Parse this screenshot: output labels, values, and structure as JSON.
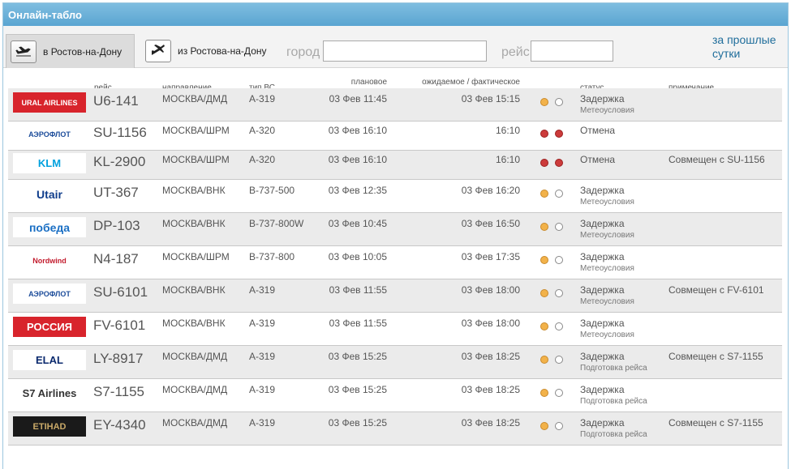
{
  "title": "Онлайн-табло",
  "tabs": [
    {
      "label": "в Ростов-на-Дону",
      "active": true
    },
    {
      "label": "из Ростова-на-Дону",
      "active": false
    }
  ],
  "filters": {
    "city_label": "город",
    "city_value": "",
    "flight_label": "рейс",
    "flight_value": ""
  },
  "prev_day_link": "за прошлые сутки",
  "headers": {
    "flight": "рейс",
    "direction": "направление",
    "aircraft": "тип ВС",
    "planned": "плановое время",
    "expected": "ожидаемое / фактическое время",
    "status": "статус",
    "note": "примечание"
  },
  "rows": [
    {
      "airline": "Ural Airlines",
      "logo": "URAL AIRLINES",
      "flight": "U6-141",
      "direction": "МОСКВА/ДМД",
      "aircraft": "A-319",
      "planned": "03 Фев 11:45",
      "expected": "03 Фев 15:15",
      "lights": [
        "orange",
        "empty"
      ],
      "status": "Задержка",
      "reason": "Метеоусловия",
      "note": ""
    },
    {
      "airline": "Aeroflot",
      "logo": "АЭРОФЛОТ",
      "flight": "SU-1156",
      "direction": "МОСКВА/ШРМ",
      "aircraft": "A-320",
      "planned": "03 Фев 16:10",
      "expected": "16:10",
      "lights": [
        "red",
        "red"
      ],
      "status": "Отмена",
      "reason": "",
      "note": ""
    },
    {
      "airline": "KLM",
      "logo": "KLM",
      "flight": "KL-2900",
      "direction": "МОСКВА/ШРМ",
      "aircraft": "A-320",
      "planned": "03 Фев 16:10",
      "expected": "16:10",
      "lights": [
        "red",
        "red"
      ],
      "status": "Отмена",
      "reason": "",
      "note": "Совмещен с SU-1156"
    },
    {
      "airline": "Utair",
      "logo": "Utair",
      "flight": "UT-367",
      "direction": "МОСКВА/ВНК",
      "aircraft": "B-737-500",
      "planned": "03 Фев 12:35",
      "expected": "03 Фев 16:20",
      "lights": [
        "orange",
        "empty"
      ],
      "status": "Задержка",
      "reason": "Метеоусловия",
      "note": ""
    },
    {
      "airline": "Pobeda",
      "logo": "победа",
      "flight": "DP-103",
      "direction": "МОСКВА/ВНК",
      "aircraft": "B-737-800W",
      "planned": "03 Фев 10:45",
      "expected": "03 Фев 16:50",
      "lights": [
        "orange",
        "empty"
      ],
      "status": "Задержка",
      "reason": "Метеоусловия",
      "note": ""
    },
    {
      "airline": "Nordwind",
      "logo": "Nordwind",
      "flight": "N4-187",
      "direction": "МОСКВА/ШРМ",
      "aircraft": "B-737-800",
      "planned": "03 Фев 10:05",
      "expected": "03 Фев 17:35",
      "lights": [
        "orange",
        "empty"
      ],
      "status": "Задержка",
      "reason": "Метеоусловия",
      "note": ""
    },
    {
      "airline": "Aeroflot",
      "logo": "АЭРОФЛОТ",
      "flight": "SU-6101",
      "direction": "МОСКВА/ВНК",
      "aircraft": "A-319",
      "planned": "03 Фев 11:55",
      "expected": "03 Фев 18:00",
      "lights": [
        "orange",
        "empty"
      ],
      "status": "Задержка",
      "reason": "Метеоусловия",
      "note": "Совмещен с FV-6101"
    },
    {
      "airline": "Rossiya",
      "logo": "РОССИЯ",
      "flight": "FV-6101",
      "direction": "МОСКВА/ВНК",
      "aircraft": "A-319",
      "planned": "03 Фев 11:55",
      "expected": "03 Фев 18:00",
      "lights": [
        "orange",
        "empty"
      ],
      "status": "Задержка",
      "reason": "Метеоусловия",
      "note": ""
    },
    {
      "airline": "El Al",
      "logo": "ELAL",
      "flight": "LY-8917",
      "direction": "МОСКВА/ДМД",
      "aircraft": "A-319",
      "planned": "03 Фев 15:25",
      "expected": "03 Фев 18:25",
      "lights": [
        "orange",
        "empty"
      ],
      "status": "Задержка",
      "reason": "Подготовка рейса",
      "note": "Совмещен с S7-1155"
    },
    {
      "airline": "S7 Airlines",
      "logo": "S7 Airlines",
      "flight": "S7-1155",
      "direction": "МОСКВА/ДМД",
      "aircraft": "A-319",
      "planned": "03 Фев 15:25",
      "expected": "03 Фев 18:25",
      "lights": [
        "orange",
        "empty"
      ],
      "status": "Задержка",
      "reason": "Подготовка рейса",
      "note": ""
    },
    {
      "airline": "Etihad",
      "logo": "ETIHAD",
      "flight": "EY-4340",
      "direction": "МОСКВА/ДМД",
      "aircraft": "A-319",
      "planned": "03 Фев 15:25",
      "expected": "03 Фев 18:25",
      "lights": [
        "orange",
        "empty"
      ],
      "status": "Задержка",
      "reason": "Подготовка рейса",
      "note": "Совмещен с S7-1155"
    }
  ]
}
